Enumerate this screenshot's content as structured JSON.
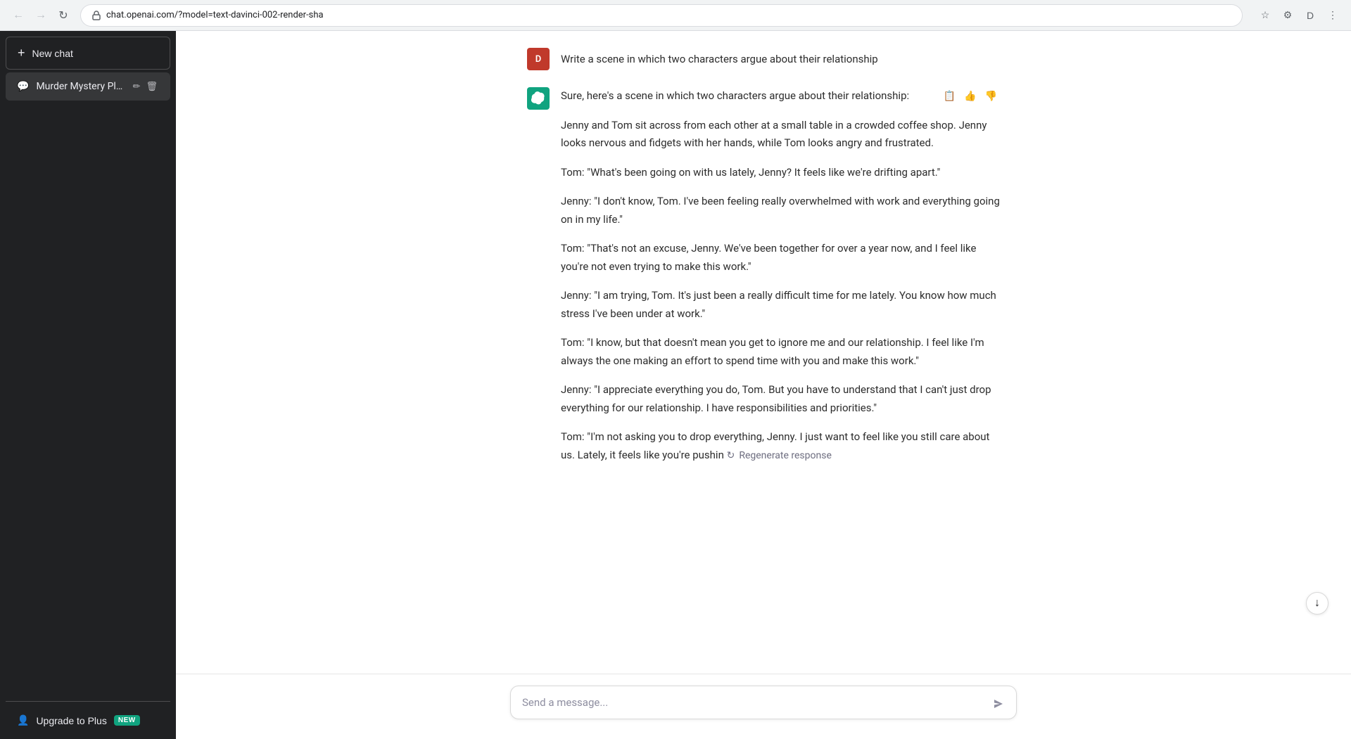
{
  "browser": {
    "url": "chat.openai.com/?model=text-davinci-002-render-sha",
    "back_disabled": true,
    "forward_disabled": true
  },
  "sidebar": {
    "new_chat_label": "New chat",
    "chats": [
      {
        "id": "murder-mystery",
        "label": "Murder Mystery Plot.",
        "active": true
      }
    ],
    "upgrade_label": "Upgrade to Plus",
    "upgrade_badge": "NEW"
  },
  "main": {
    "user_avatar_letter": "D",
    "user_message": "Write a scene in which two characters argue about their relationship",
    "ai_response_intro": "Sure, here's a scene in which two characters argue about their relationship:",
    "ai_paragraphs": [
      "Jenny and Tom sit across from each other at a small table in a crowded coffee shop. Jenny looks nervous and fidgets with her hands, while Tom looks angry and frustrated.",
      "Tom: \"What's been going on with us lately, Jenny? It feels like we're drifting apart.\"",
      "Jenny: \"I don't know, Tom. I've been feeling really overwhelmed with work and everything going on in my life.\"",
      "Tom: \"That's not an excuse, Jenny. We've been together for over a year now, and I feel like you're not even trying to make this work.\"",
      "Jenny: \"I am trying, Tom. It's just been a really difficult time for me lately. You know how much stress I've been under at work.\"",
      "Tom: \"I know, but that doesn't mean you get to ignore me and our relationship. I feel like I'm always the one making an effort to spend time with you and make this work.\"",
      "Jenny: \"I appreciate everything you do, Tom. But you have to understand that I can't just drop everything for our relationship. I have responsibilities and priorities.\"",
      "Tom: \"I'm not asking you to drop everything, Jenny. I just want to feel like you still care about us. Lately, it feels like you're pushin"
    ],
    "regenerate_label": "Regenerate response",
    "input_placeholder": "Send a message...",
    "copy_icon": "📋",
    "thumbup_icon": "👍",
    "thumbdown_icon": "👎",
    "edit_icon": "✏️",
    "delete_icon": "🗑️"
  }
}
